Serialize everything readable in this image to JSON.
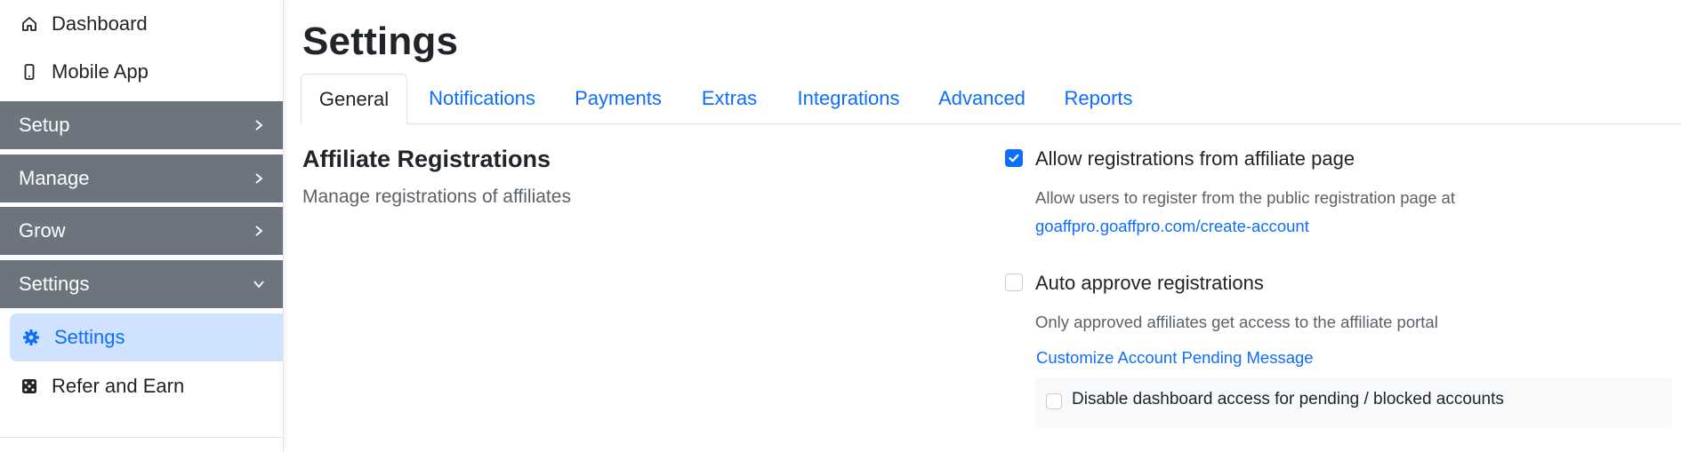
{
  "sidebar": {
    "links": [
      {
        "label": "Dashboard",
        "icon": "home-icon"
      },
      {
        "label": "Mobile App",
        "icon": "mobile-icon"
      }
    ],
    "groups": [
      {
        "label": "Setup",
        "expanded": false
      },
      {
        "label": "Manage",
        "expanded": false
      },
      {
        "label": "Grow",
        "expanded": false
      },
      {
        "label": "Settings",
        "expanded": true
      }
    ],
    "sub_items": [
      {
        "label": "Settings",
        "icon": "gear-icon",
        "active": true
      },
      {
        "label": "Refer and Earn",
        "icon": "dice-icon",
        "active": false
      }
    ]
  },
  "page": {
    "title": "Settings",
    "tabs": [
      {
        "label": "General",
        "active": true
      },
      {
        "label": "Notifications",
        "active": false
      },
      {
        "label": "Payments",
        "active": false
      },
      {
        "label": "Extras",
        "active": false
      },
      {
        "label": "Integrations",
        "active": false
      },
      {
        "label": "Advanced",
        "active": false
      },
      {
        "label": "Reports",
        "active": false
      }
    ]
  },
  "section": {
    "title": "Affiliate Registrations",
    "subtitle": "Manage registrations of affiliates"
  },
  "options": {
    "allow_registrations": {
      "label": "Allow registrations from affiliate page",
      "checked": true,
      "help": "Allow users to register from the public registration page at",
      "link": "goaffpro.goaffpro.com/create-account"
    },
    "auto_approve": {
      "label": "Auto approve registrations",
      "checked": false,
      "help": "Only approved affiliates get access to the affiliate portal",
      "link": "Customize Account Pending Message"
    },
    "disable_dashboard": {
      "label": "Disable dashboard access for pending / blocked accounts",
      "checked": false
    }
  },
  "colors": {
    "accent": "#0d6efd",
    "sidebar_group_bg": "#6c757d",
    "active_item_bg": "#cfe2ff",
    "text": "#212529",
    "muted_text": "#5a6168"
  }
}
